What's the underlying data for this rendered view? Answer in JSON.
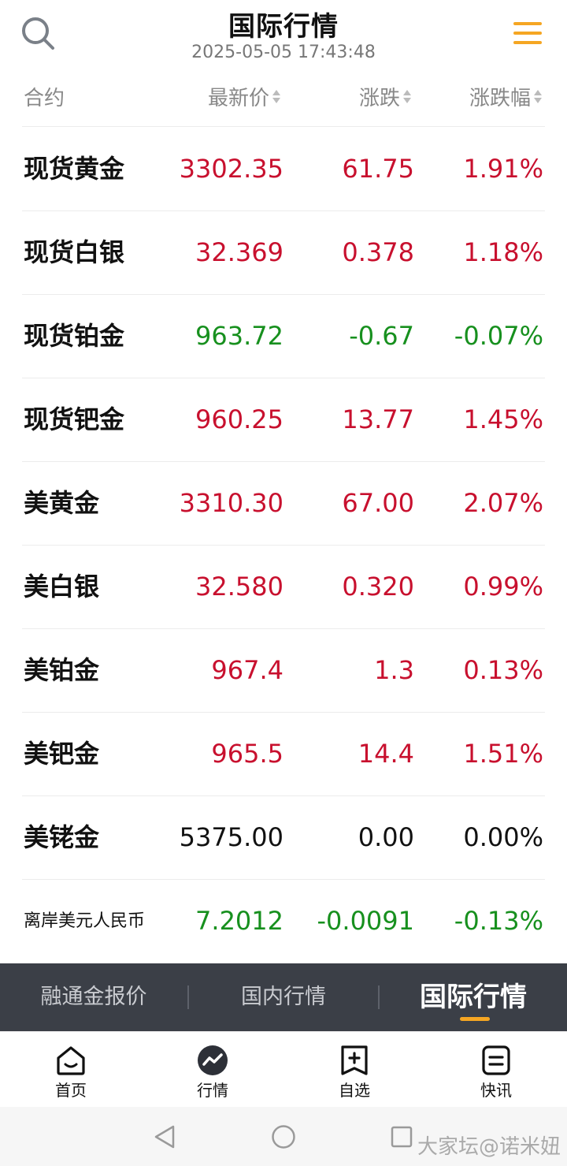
{
  "header": {
    "title": "国际行情",
    "datetime": "2025-05-05 17:43:48"
  },
  "columns": {
    "name": "合约",
    "price": "最新价",
    "change": "涨跌",
    "percent": "涨跌幅"
  },
  "rows": [
    {
      "name": "现货黄金",
      "price": "3302.35",
      "change": "61.75",
      "percent": "1.91%",
      "trend": "up"
    },
    {
      "name": "现货白银",
      "price": "32.369",
      "change": "0.378",
      "percent": "1.18%",
      "trend": "up"
    },
    {
      "name": "现货铂金",
      "price": "963.72",
      "change": "-0.67",
      "percent": "-0.07%",
      "trend": "down"
    },
    {
      "name": "现货钯金",
      "price": "960.25",
      "change": "13.77",
      "percent": "1.45%",
      "trend": "up"
    },
    {
      "name": "美黄金",
      "price": "3310.30",
      "change": "67.00",
      "percent": "2.07%",
      "trend": "up"
    },
    {
      "name": "美白银",
      "price": "32.580",
      "change": "0.320",
      "percent": "0.99%",
      "trend": "up"
    },
    {
      "name": "美铂金",
      "price": "967.4",
      "change": "1.3",
      "percent": "0.13%",
      "trend": "up"
    },
    {
      "name": "美钯金",
      "price": "965.5",
      "change": "14.4",
      "percent": "1.51%",
      "trend": "up"
    },
    {
      "name": "美铑金",
      "price": "5375.00",
      "change": "0.00",
      "percent": "0.00%",
      "trend": "flat"
    },
    {
      "name": "离岸美元人民币",
      "price": "7.2012",
      "change": "-0.0091",
      "percent": "-0.13%",
      "trend": "down"
    }
  ],
  "segment_tabs": [
    {
      "label": "融通金报价"
    },
    {
      "label": "国内行情"
    },
    {
      "label": "国际行情",
      "active": true
    }
  ],
  "bottom_nav": [
    {
      "label": "首页",
      "icon": "home-icon"
    },
    {
      "label": "行情",
      "icon": "market-trend-icon",
      "active": true
    },
    {
      "label": "自选",
      "icon": "add-bookmark-icon"
    },
    {
      "label": "快讯",
      "icon": "news-icon"
    }
  ],
  "watermark": "大家坛@诺米妞",
  "colors": {
    "up": "#c8102e",
    "down": "#17901e",
    "accent": "#f5a623",
    "tab_bar": "#3b3f47"
  }
}
